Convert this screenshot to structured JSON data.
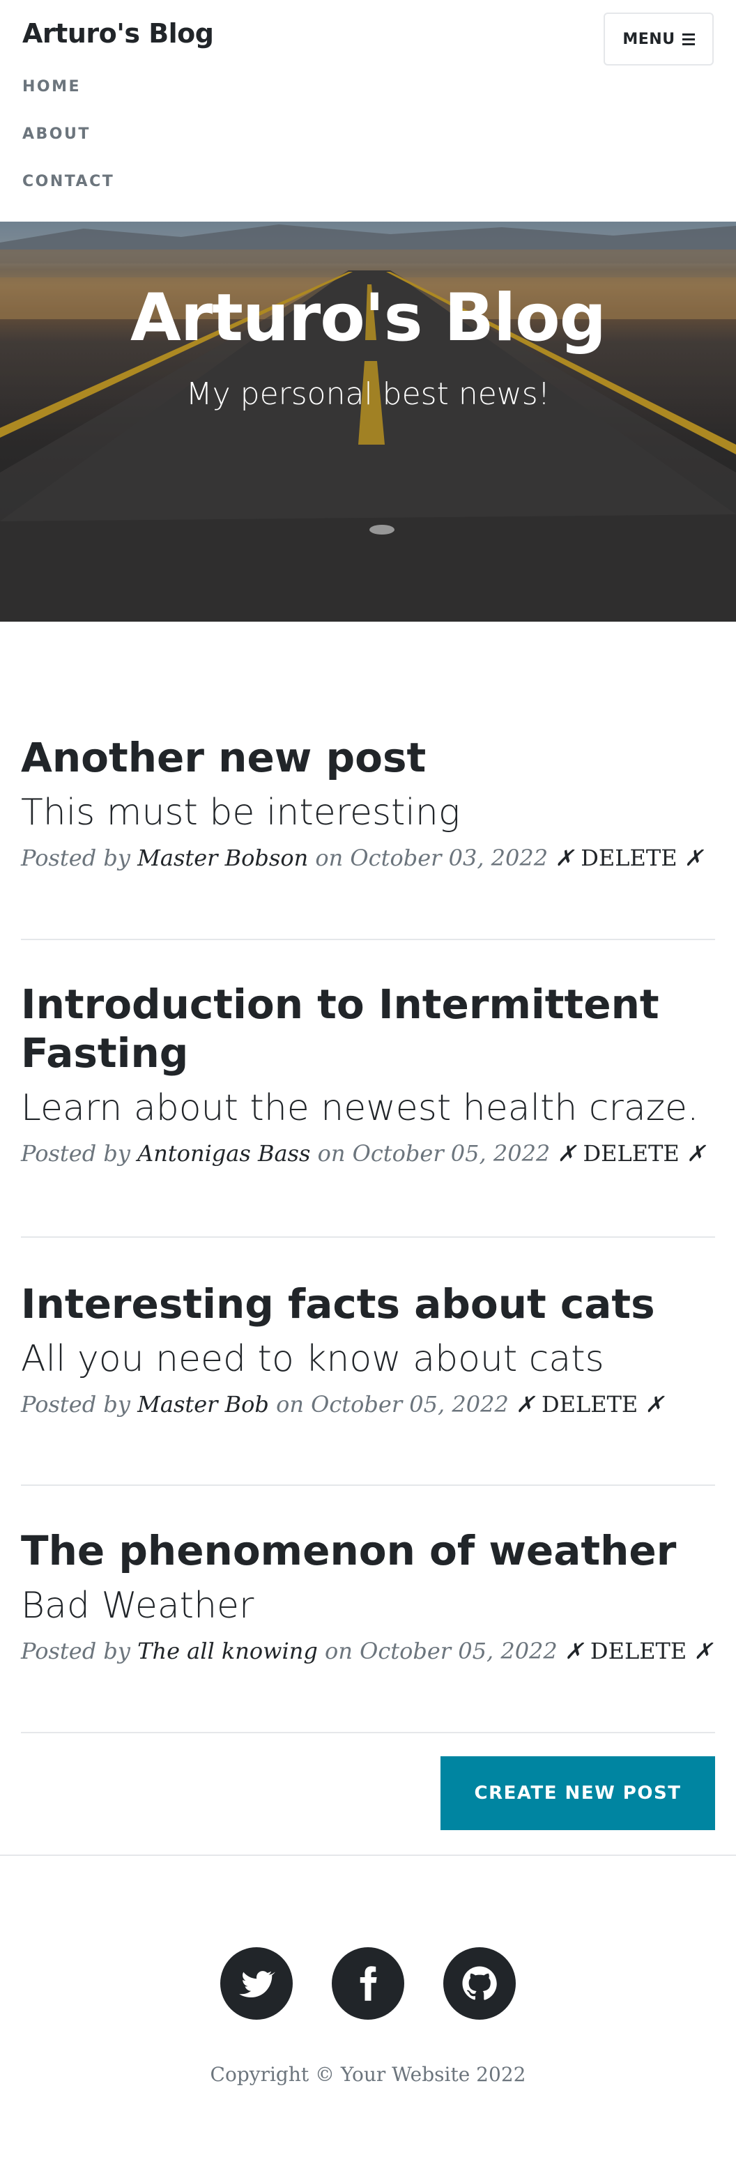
{
  "navbar": {
    "brand": "Arturo's Blog",
    "menu_label": "MENU",
    "links": [
      "HOME",
      "ABOUT",
      "CONTACT"
    ]
  },
  "hero": {
    "title": "Arturo's Blog",
    "subtitle": "My personal best news!"
  },
  "posts": [
    {
      "title": "Another new post",
      "subtitle": "This must be interesting",
      "posted_by": "Posted by",
      "author": "Master Bobson",
      "on": "on",
      "date": "October 03, 2022",
      "delete_mark": "✗",
      "delete_label": "DELETE"
    },
    {
      "title": "Introduction to Intermittent Fasting",
      "subtitle": "Learn about the newest health craze.",
      "posted_by": "Posted by",
      "author": "Antonigas Bass",
      "on": "on",
      "date": "October 05, 2022",
      "delete_mark": "✗",
      "delete_label": "DELETE"
    },
    {
      "title": "Interesting facts about cats",
      "subtitle": "All you need to know about cats",
      "posted_by": "Posted by",
      "author": "Master Bob",
      "on": "on",
      "date": "October 05, 2022",
      "delete_mark": "✗",
      "delete_label": "DELETE"
    },
    {
      "title": "The phenomenon of weather",
      "subtitle": "Bad Weather",
      "posted_by": "Posted by",
      "author": "The all knowing",
      "on": "on",
      "date": "October 05, 2022",
      "delete_mark": "✗",
      "delete_label": "DELETE"
    }
  ],
  "create_button": "CREATE NEW POST",
  "footer": {
    "social": [
      "twitter-icon",
      "facebook-icon",
      "github-icon"
    ],
    "copyright": "Copyright © Your Website 2022"
  },
  "colors": {
    "accent": "#0085a1",
    "text": "#212529",
    "muted": "#6c757d"
  }
}
